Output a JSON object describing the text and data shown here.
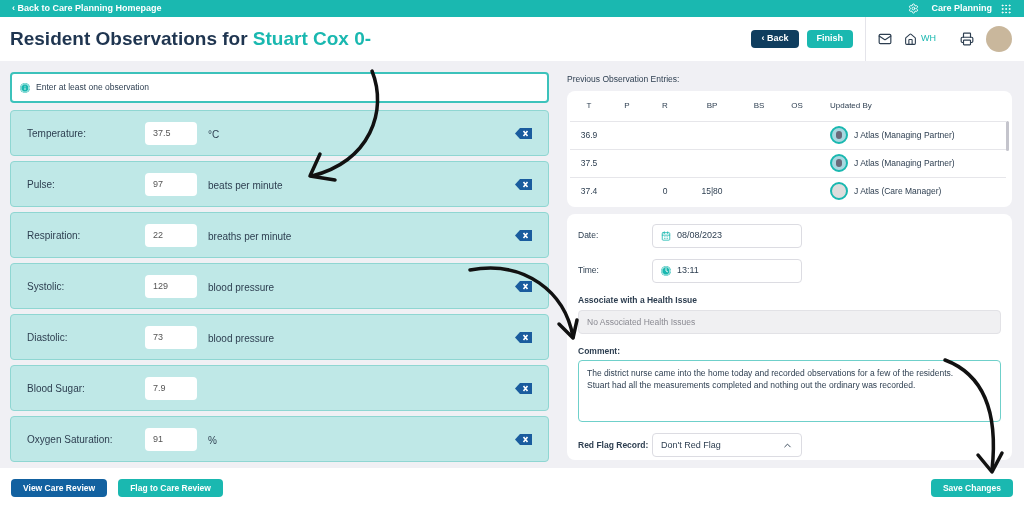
{
  "top_bar": {
    "back_link": "‹ Back to Care Planning Homepage",
    "app_name": "Care Planning"
  },
  "header": {
    "title": "Resident Observations for",
    "resident": "Stuart Cox 0-",
    "buttons": [
      {
        "label": "‹ Back",
        "kind": "dark"
      },
      {
        "label": "Finish",
        "kind": "teal"
      }
    ],
    "home_label": "WH"
  },
  "alert": "Enter at least one observation",
  "observations": [
    {
      "label": "Temperature:",
      "value": "37.5",
      "unit": "°C"
    },
    {
      "label": "Pulse:",
      "value": "97",
      "unit": "beats per minute"
    },
    {
      "label": "Respiration:",
      "value": "22",
      "unit": "breaths per minute"
    },
    {
      "label": "Systolic:",
      "value": "129",
      "unit": "blood pressure"
    },
    {
      "label": "Diastolic:",
      "value": "73",
      "unit": "blood pressure"
    },
    {
      "label": "Blood Sugar:",
      "value": "7.9"
    },
    {
      "label": "Oxygen Saturation:",
      "value": "91",
      "unit": "%"
    }
  ],
  "previous": {
    "title": "Previous Observation Entries:",
    "columns": [
      "T",
      "P",
      "R",
      "BP",
      "BS",
      "OS",
      "Updated By"
    ],
    "rows": [
      {
        "cells": [
          "36.9",
          "",
          "",
          "",
          "",
          ""
        ],
        "updated_by": "J Atlas (Managing Partner)",
        "kind": "drawing"
      },
      {
        "cells": [
          "37.5",
          "",
          "",
          "",
          "",
          ""
        ],
        "updated_by": "J Atlas (Managing Partner)",
        "kind": "drawing"
      },
      {
        "cells": [
          "37.4",
          "",
          "0",
          "15|80",
          "",
          ""
        ],
        "updated_by": "J Atlas (Care Manager)",
        "kind": "blank"
      }
    ]
  },
  "form": {
    "date_label": "Date:",
    "date": "08/08/2023",
    "time_label": "Time:",
    "time": "13:11",
    "health_label": "Associate with a Health Issue",
    "health_placeholder": "No Associated Health Issues",
    "comment_label": "Comment:",
    "comment": "The district nurse came into the home today and recorded observations for a few of the residents.\nStuart had all the measurements completed and nothing out the ordinary was recorded.\n",
    "red_flag_label": "Red Flag Record:",
    "red_flag": "Don't Red Flag"
  },
  "footer": {
    "left_buttons": [
      {
        "label": "View Care Review",
        "kind": "dark"
      },
      {
        "label": "Flag to Care Review",
        "kind": "teal"
      }
    ],
    "save": "Save Changes"
  }
}
